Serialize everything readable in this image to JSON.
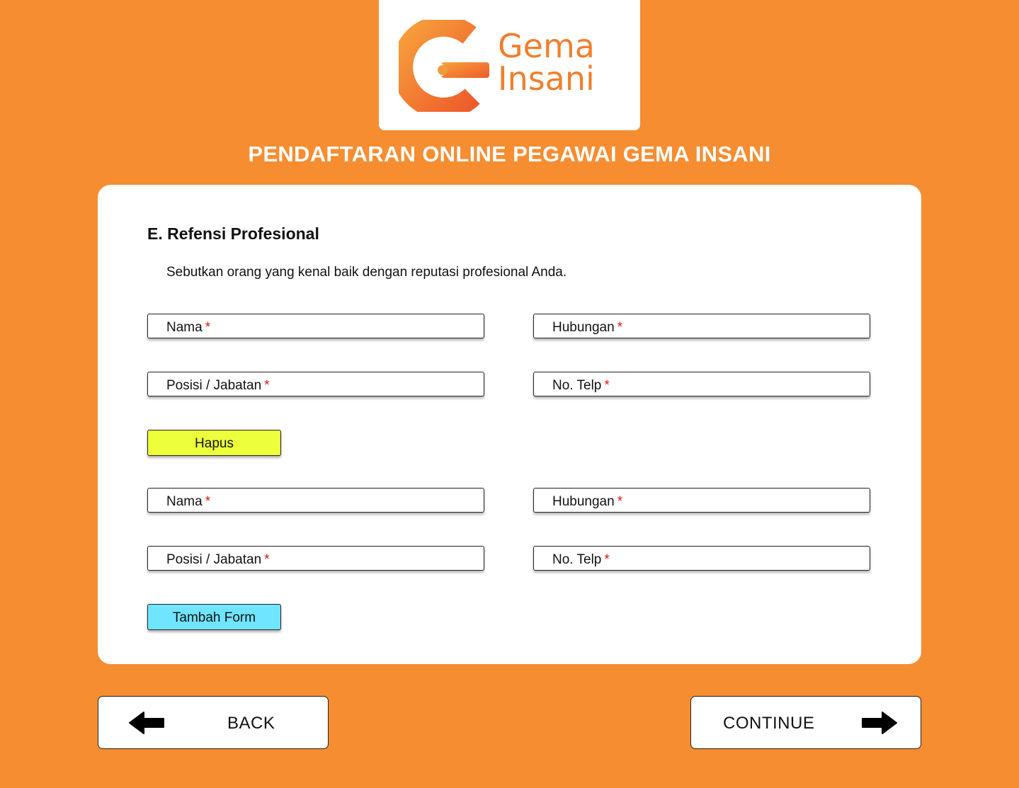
{
  "brand": {
    "name_line1": "Gema",
    "name_line2": "Insani",
    "logo_icon": "gema-g-logo-icon",
    "color": "#F07F2E"
  },
  "page_title": "PENDAFTARAN ONLINE PEGAWAI GEMA INSANI",
  "section": {
    "title": "E. Refensi Profesional",
    "description": "Sebutkan orang yang kenal baik dengan reputasi profesional Anda."
  },
  "forms": [
    {
      "nama_label": "Nama",
      "hubungan_label": "Hubungan",
      "posisi_label": "Posisi / Jabatan",
      "telp_label": "No. Telp",
      "required_mark": "*"
    },
    {
      "nama_label": "Nama",
      "hubungan_label": "Hubungan",
      "posisi_label": "Posisi / Jabatan",
      "telp_label": "No. Telp",
      "required_mark": "*"
    }
  ],
  "buttons": {
    "hapus": "Hapus",
    "tambah_form": "Tambah Form",
    "back": "BACK",
    "continue": "CONTINUE"
  },
  "icons": {
    "back": "arrow-left-icon",
    "continue": "arrow-right-icon"
  },
  "colors": {
    "background": "#F68D31",
    "hapus_button": "#EDFF3A",
    "tambah_button": "#6FE5FF",
    "required": "#E11414"
  }
}
